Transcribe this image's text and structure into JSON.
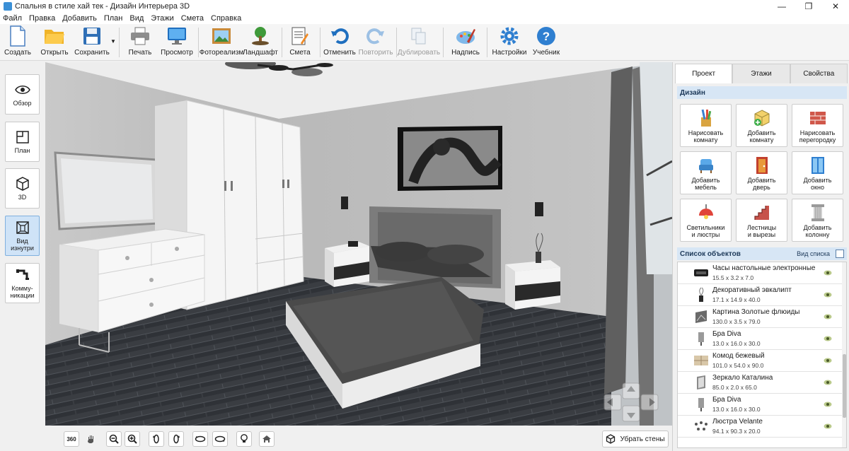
{
  "window": {
    "title": "Спальня в стиле хай тек - Дизайн Интерьера 3D",
    "minimize_glyph": "—",
    "maximize_glyph": "❐",
    "close_glyph": "✕"
  },
  "menu": [
    "Файл",
    "Правка",
    "Добавить",
    "План",
    "Вид",
    "Этажи",
    "Смета",
    "Справка"
  ],
  "toolbar": {
    "create": "Создать",
    "open": "Открыть",
    "save": "Сохранить",
    "print": "Печать",
    "preview": "Просмотр",
    "photorealism": "Фотореализм",
    "landscape": "Ландшафт",
    "estimate": "Смета",
    "undo": "Отменить",
    "redo": "Повторить",
    "duplicate": "Дублировать",
    "caption": "Надпись",
    "settings": "Настройки",
    "tutorial": "Учебник"
  },
  "left_panel": {
    "overview": "Обзор",
    "plan": "План",
    "view3d": "3D",
    "inside_view_l1": "Вид",
    "inside_view_l2": "изнутри",
    "communications_l1": "Комму-",
    "communications_l2": "никации"
  },
  "right_panel": {
    "tabs": [
      "Проект",
      "Этажи",
      "Свойства"
    ],
    "design_header": "Дизайн",
    "design_buttons": [
      {
        "l1": "Нарисовать",
        "l2": "комнату"
      },
      {
        "l1": "Добавить",
        "l2": "комнату"
      },
      {
        "l1": "Нарисовать",
        "l2": "перегородку"
      },
      {
        "l1": "Добавить",
        "l2": "мебель"
      },
      {
        "l1": "Добавить",
        "l2": "дверь"
      },
      {
        "l1": "Добавить",
        "l2": "окно"
      },
      {
        "l1": "Светильники",
        "l2": "и люстры"
      },
      {
        "l1": "Лестницы",
        "l2": "и вырезы"
      },
      {
        "l1": "Добавить",
        "l2": "колонну"
      }
    ],
    "objects_header": "Список объектов",
    "list_view": "Вид списка",
    "objects": [
      {
        "name": "Часы настольные электронные",
        "dims": "15.5 x 3.2 x 7.0"
      },
      {
        "name": "Декоративный эвкалипт",
        "dims": "17.1 x 14.9 x 40.0"
      },
      {
        "name": "Картина Золотые флюиды",
        "dims": "130.0 x 3.5 x 79.0"
      },
      {
        "name": "Бра Diva",
        "dims": "13.0 x 16.0 x 30.0"
      },
      {
        "name": "Комод бежевый",
        "dims": "101.0 x 54.0 x 90.0"
      },
      {
        "name": "Зеркало Каталина",
        "dims": "85.0 x 2.0 x 65.0"
      },
      {
        "name": "Бра Diva",
        "dims": "13.0 x 16.0 x 30.0"
      },
      {
        "name": "Люстра Velante",
        "dims": "94.1 x 90.3 x 20.0"
      }
    ]
  },
  "bottom_bar": {
    "view360": "360",
    "remove_walls": "Убрать стены"
  }
}
